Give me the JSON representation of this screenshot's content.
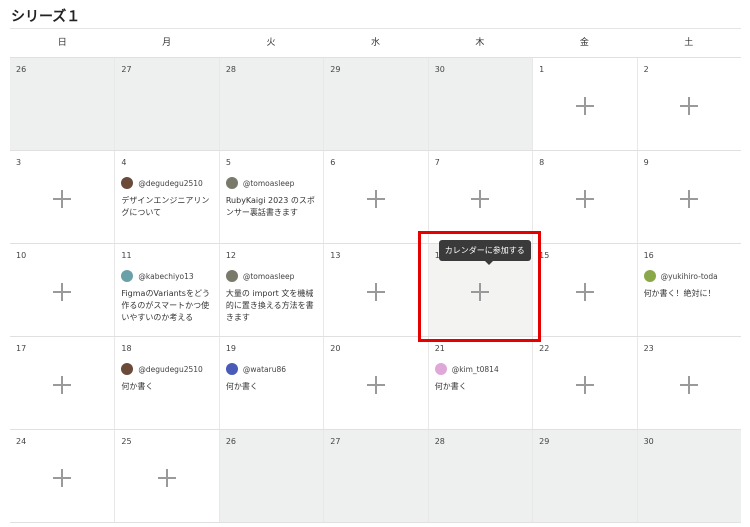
{
  "title": "シリーズ１",
  "weekdays": [
    "日",
    "月",
    "火",
    "水",
    "木",
    "金",
    "土"
  ],
  "tooltip": "カレンダーに参加する",
  "colors": {
    "highlight": "#e60000",
    "out_of_month": "#eef0ef",
    "plus": "#9a9a9a"
  },
  "weeks": [
    [
      {
        "date": "26",
        "out": true
      },
      {
        "date": "27",
        "out": true
      },
      {
        "date": "28",
        "out": true
      },
      {
        "date": "29",
        "out": true
      },
      {
        "date": "30",
        "out": true
      },
      {
        "date": "1",
        "plus": true
      },
      {
        "date": "2",
        "plus": true
      }
    ],
    [
      {
        "date": "3",
        "plus": true
      },
      {
        "date": "4",
        "user": "@degudegu2510",
        "avatar_color": "#6a4b3a",
        "entry_title": "デザインエンジニアリングについて"
      },
      {
        "date": "5",
        "user": "@tomoasleep",
        "avatar_color": "#7a7a6a",
        "entry_title": "RubyKaigi 2023 のスポンサー裏話書きます"
      },
      {
        "date": "6",
        "plus": true
      },
      {
        "date": "7",
        "plus": true
      },
      {
        "date": "8",
        "plus": true
      },
      {
        "date": "9",
        "plus": true
      }
    ],
    [
      {
        "date": "10",
        "plus": true
      },
      {
        "date": "11",
        "user": "@kabechiyo13",
        "avatar_color": "#6aa0a8",
        "entry_title": "FigmaのVariantsをどう作るのがスマートかつ使いやすいのか考える"
      },
      {
        "date": "12",
        "user": "@tomoasleep",
        "avatar_color": "#7a7a6a",
        "entry_title": "大量の import 文を機械的に置き換える方法を書きます"
      },
      {
        "date": "13",
        "plus": true
      },
      {
        "date": "14",
        "plus": true,
        "hl": true,
        "tooltip": true
      },
      {
        "date": "15",
        "plus": true
      },
      {
        "date": "16",
        "user": "@yukihiro-toda",
        "avatar_color": "#8aa84a",
        "entry_title": "何か書く！絶対に！"
      }
    ],
    [
      {
        "date": "17",
        "plus": true
      },
      {
        "date": "18",
        "user": "@degudegu2510",
        "avatar_color": "#6a4b3a",
        "entry_title": "何か書く"
      },
      {
        "date": "19",
        "user": "@wataru86",
        "avatar_color": "#4a5ab8",
        "entry_title": "何か書く"
      },
      {
        "date": "20",
        "plus": true
      },
      {
        "date": "21",
        "user": "@kim_t0814",
        "avatar_color": "#e0a8d8",
        "entry_title": "何か書く"
      },
      {
        "date": "22",
        "plus": true
      },
      {
        "date": "23",
        "plus": true
      }
    ],
    [
      {
        "date": "24",
        "plus": true
      },
      {
        "date": "25",
        "plus": true
      },
      {
        "date": "26",
        "out": true
      },
      {
        "date": "27",
        "out": true
      },
      {
        "date": "28",
        "out": true
      },
      {
        "date": "29",
        "out": true
      },
      {
        "date": "30",
        "out": true
      }
    ]
  ]
}
